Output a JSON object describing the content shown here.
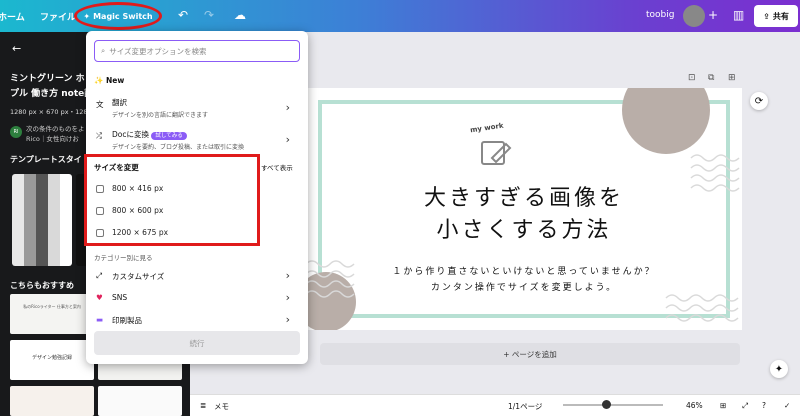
{
  "topbar": {
    "home": "ホーム",
    "file": "ファイル",
    "magic_switch": "Magic Switch",
    "project_name": "toobig",
    "share": "共有"
  },
  "left_panel": {
    "title_line1": "ミントグリーン ホ",
    "title_line2": "プル 働き方 note記",
    "dims": "1280 px × 670 px・1280",
    "rico_line1": "次の条件のものをよ",
    "rico_line2": "Rico｜女性向けお",
    "rico_initials": "RI",
    "templates_title": "テンプレートスタイ",
    "recommend_title": "こちらもおすすめ",
    "show_all": "すべて表示",
    "thumb1": "私のRicoライター 仕事方と案内",
    "thumb2": "デザイン勉強記録"
  },
  "dropdown": {
    "search_placeholder": "サイズ変更オプションを検索",
    "new_label": "New",
    "translate_title": "翻訳",
    "translate_sub": "デザインを別の言語に翻訳できます",
    "doc_title": "Docに変換",
    "doc_badge": "試してみる",
    "doc_sub": "デザインを要約、ブログ投稿、または取引に変換",
    "resize_title": "サイズを変更",
    "sizes": [
      "800 × 416 px",
      "800 × 600 px",
      "1200 × 675 px"
    ],
    "category_label": "カテゴリー別に見る",
    "custom_size": "カスタムサイズ",
    "sns": "SNS",
    "print": "印刷製品",
    "continue": "続行"
  },
  "canvas": {
    "tag": "my work",
    "headline1": "大きすぎる画像を",
    "headline2": "小さくする方法",
    "sub1": "１から作り直さないといけないと思っていませんか？",
    "sub2": "カンタン操作でサイズを変更しよう。"
  },
  "add_page": "+ ページを追加",
  "bottombar": {
    "memo": "メモ",
    "pages": "1/1ページ",
    "zoom": "46%",
    "zoom_value": 46
  },
  "colors": {
    "accent": "#8b5cf6",
    "highlight": "#e01b1b",
    "mint": "#b7e0d3",
    "taupe": "#b9aea8"
  }
}
